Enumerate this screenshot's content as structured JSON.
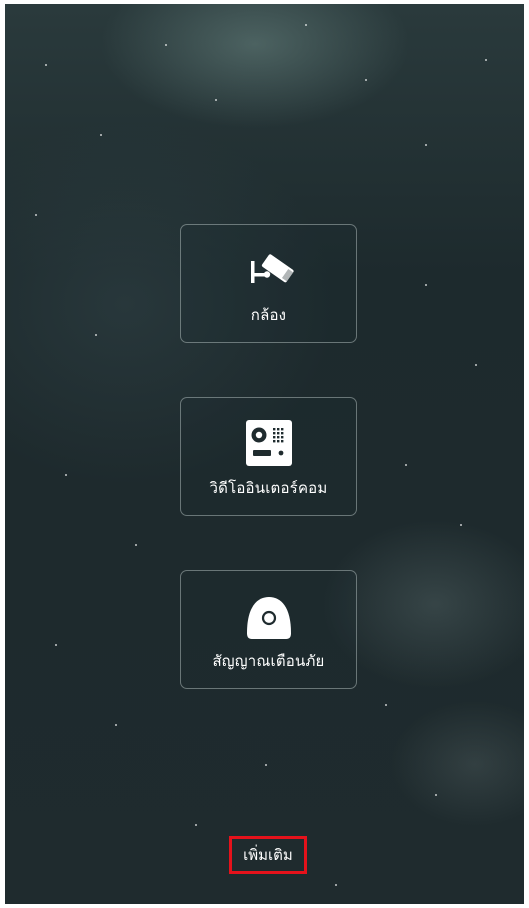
{
  "tiles": [
    {
      "id": "camera",
      "label": "กล้อง",
      "icon": "security-camera-icon"
    },
    {
      "id": "intercom",
      "label": "วิดีโออินเตอร์คอม",
      "icon": "video-intercom-icon"
    },
    {
      "id": "alarm",
      "label": "สัญญาณเตือนภัย",
      "icon": "alarm-sensor-icon"
    }
  ],
  "more_button": {
    "label": "เพิ่มเติม"
  },
  "colors": {
    "background": "#1f2b2e",
    "tile_border": "#b9c4c4",
    "text": "#ffffff",
    "highlight": "#e5121b"
  }
}
